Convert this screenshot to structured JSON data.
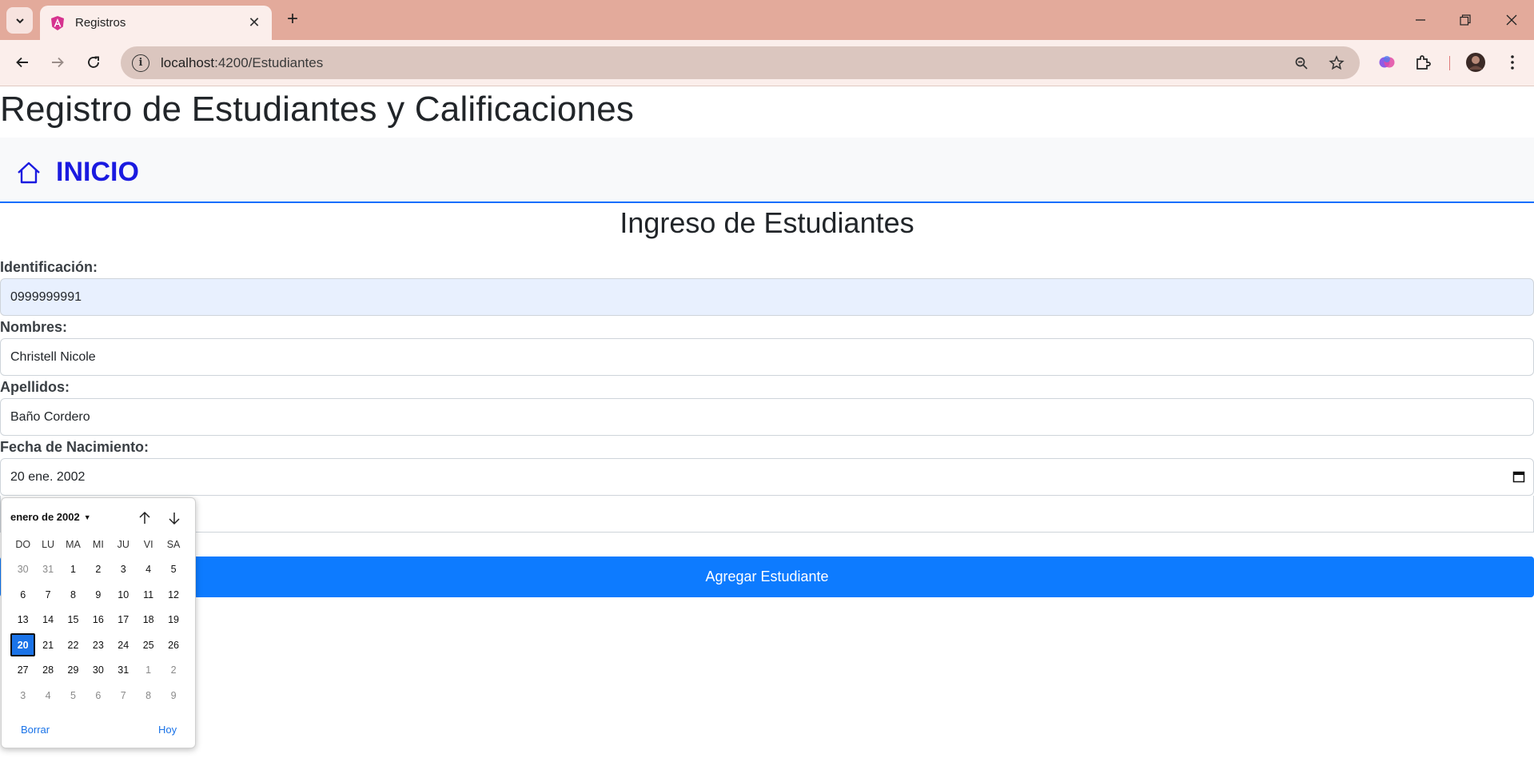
{
  "browser": {
    "tab_title": "Registros",
    "url_host": "localhost",
    "url_rest": ":4200/Estudiantes"
  },
  "page": {
    "title": "Registro de Estudiantes y Calificaciones",
    "nav_home_label": "INICIO",
    "section_title": "Ingreso de Estudiantes"
  },
  "form": {
    "id_label": "Identificación:",
    "id_value": "0999999991",
    "names_label": "Nombres:",
    "names_value": "Christell Nicole",
    "lastnames_label": "Apellidos:",
    "lastnames_value": "Baño Cordero",
    "birth_label": "Fecha de Nacimiento:",
    "birth_value": "20 ene. 2002",
    "submit_label": "Agregar Estudiante"
  },
  "datepicker": {
    "month_label": "enero de 2002",
    "weekdays": [
      "DO",
      "LU",
      "MA",
      "MI",
      "JU",
      "VI",
      "SA"
    ],
    "weeks": [
      [
        {
          "d": "30",
          "dim": true
        },
        {
          "d": "31",
          "dim": true
        },
        {
          "d": "1"
        },
        {
          "d": "2"
        },
        {
          "d": "3"
        },
        {
          "d": "4"
        },
        {
          "d": "5"
        }
      ],
      [
        {
          "d": "6"
        },
        {
          "d": "7"
        },
        {
          "d": "8"
        },
        {
          "d": "9"
        },
        {
          "d": "10"
        },
        {
          "d": "11"
        },
        {
          "d": "12"
        }
      ],
      [
        {
          "d": "13"
        },
        {
          "d": "14"
        },
        {
          "d": "15"
        },
        {
          "d": "16"
        },
        {
          "d": "17"
        },
        {
          "d": "18"
        },
        {
          "d": "19"
        }
      ],
      [
        {
          "d": "20",
          "sel": true
        },
        {
          "d": "21"
        },
        {
          "d": "22"
        },
        {
          "d": "23"
        },
        {
          "d": "24"
        },
        {
          "d": "25"
        },
        {
          "d": "26"
        }
      ],
      [
        {
          "d": "27"
        },
        {
          "d": "28"
        },
        {
          "d": "29"
        },
        {
          "d": "30"
        },
        {
          "d": "31"
        },
        {
          "d": "1",
          "dim": true
        },
        {
          "d": "2",
          "dim": true
        }
      ],
      [
        {
          "d": "3",
          "dim": true
        },
        {
          "d": "4",
          "dim": true
        },
        {
          "d": "5",
          "dim": true
        },
        {
          "d": "6",
          "dim": true
        },
        {
          "d": "7",
          "dim": true
        },
        {
          "d": "8",
          "dim": true
        },
        {
          "d": "9",
          "dim": true
        }
      ]
    ],
    "clear_label": "Borrar",
    "today_label": "Hoy"
  },
  "colors": {
    "primary": "#0d7bff",
    "nav_link": "#1a1ae0",
    "chrome_frame": "#e3aa9b"
  }
}
